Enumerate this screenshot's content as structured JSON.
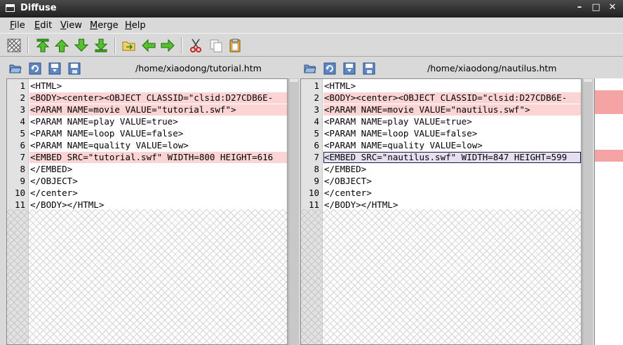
{
  "window": {
    "title": "Diffuse",
    "minimize": "–",
    "maximize": "□",
    "close": "✕"
  },
  "menu": [
    "File",
    "Edit",
    "View",
    "Merge",
    "Help"
  ],
  "toolbar": [
    "realign-icon",
    "first-difference-icon",
    "previous-difference-icon",
    "next-difference-icon",
    "last-difference-icon",
    "merge-folder-icon",
    "copy-left-icon",
    "copy-right-icon",
    "cut-icon",
    "copy-icon",
    "paste-icon"
  ],
  "colors": {
    "diff": "#fcd4d4",
    "selected": "#e6dff2",
    "overview": "#f5a4a4"
  },
  "left": {
    "path": "/home/xiaodong/tutorial.htm",
    "lines": [
      {
        "n": "1",
        "text": "<HTML>",
        "diff": false
      },
      {
        "n": "2",
        "text": "<BODY><center><OBJECT CLASSID=\"clsid:D27CDB6E-",
        "diff": true
      },
      {
        "n": "3",
        "text": "<PARAM NAME=movie VALUE=\"tutorial.swf\">",
        "diff": true
      },
      {
        "n": "4",
        "text": "<PARAM NAME=play VALUE=true>",
        "diff": false
      },
      {
        "n": "5",
        "text": "<PARAM NAME=loop VALUE=false>",
        "diff": false
      },
      {
        "n": "6",
        "text": "<PARAM NAME=quality VALUE=low>",
        "diff": false
      },
      {
        "n": "7",
        "text": "<EMBED SRC=\"tutorial.swf\" WIDTH=800 HEIGHT=616",
        "diff": true
      },
      {
        "n": "8",
        "text": "</EMBED>",
        "diff": false
      },
      {
        "n": "9",
        "text": "</OBJECT>",
        "diff": false
      },
      {
        "n": "10",
        "text": "</center>",
        "diff": false
      },
      {
        "n": "11",
        "text": "</BODY></HTML>",
        "diff": false
      }
    ]
  },
  "right": {
    "path": "/home/xiaodong/nautilus.htm",
    "lines": [
      {
        "n": "1",
        "text": "<HTML>",
        "diff": false
      },
      {
        "n": "2",
        "text": "<BODY><center><OBJECT CLASSID=\"clsid:D27CDB6E-",
        "diff": true
      },
      {
        "n": "3",
        "text": "<PARAM NAME=movie VALUE=\"nautilus.swf\">",
        "diff": true
      },
      {
        "n": "4",
        "text": "<PARAM NAME=play VALUE=true>",
        "diff": false
      },
      {
        "n": "5",
        "text": "<PARAM NAME=loop VALUE=false>",
        "diff": false
      },
      {
        "n": "6",
        "text": "<PARAM NAME=quality VALUE=low>",
        "diff": false
      },
      {
        "n": "7",
        "text": "<EMBED SRC=\"nautilus.swf\" WIDTH=847 HEIGHT=599",
        "diff": true,
        "selected": true
      },
      {
        "n": "8",
        "text": "</EMBED>",
        "diff": false
      },
      {
        "n": "9",
        "text": "</OBJECT>",
        "diff": false
      },
      {
        "n": "10",
        "text": "</center>",
        "diff": false
      },
      {
        "n": "11",
        "text": "</BODY></HTML>",
        "diff": false
      }
    ]
  }
}
